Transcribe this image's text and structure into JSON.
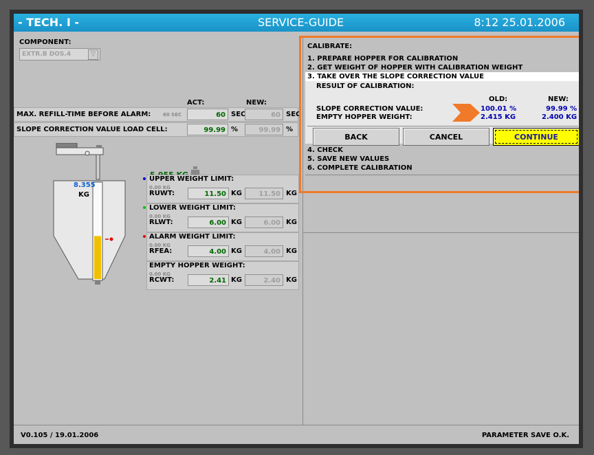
{
  "titlebar": {
    "left": "- TECH. I -",
    "center": "SERVICE-GUIDE",
    "right": "8:12  25.01.2006"
  },
  "component": {
    "label": "COMPONENT:",
    "value": "EXTR.B DOS.4"
  },
  "columns": {
    "act": "ACT:",
    "new": "NEW:"
  },
  "params": [
    {
      "label": "MAX. REFILL-TIME BEFORE ALARM:",
      "small": "60 SEC",
      "act": "60",
      "act_unit": "SEC",
      "new": "60",
      "new_unit": "SEC"
    },
    {
      "label": "SLOPE CORRECTION VALUE LOAD CELL:",
      "act": "99.99",
      "act_unit": "%",
      "new": "99.99",
      "new_unit": "%"
    }
  ],
  "hopper": {
    "weight": "5.955 KG",
    "level_value": "8.355",
    "level_unit": "KG",
    "fill_fraction": 0.45
  },
  "limits": [
    {
      "title": "UPPER WEIGHT LIMIT:",
      "small": "0.00 KG",
      "code": "RUWT:",
      "act": "11.50",
      "unit": "KG",
      "new": "11.50",
      "new_unit": "KG",
      "color": "#0000d0"
    },
    {
      "title": "LOWER WEIGHT LIMIT:",
      "small": "0.00 KG",
      "code": "RLWT:",
      "act": "6.00",
      "unit": "KG",
      "new": "6.00",
      "new_unit": "KG",
      "color": "#00c000"
    },
    {
      "title": "ALARM WEIGHT LIMIT:",
      "small": "0.00 KG",
      "code": "RFEA:",
      "act": "4.00",
      "unit": "KG",
      "new": "4.00",
      "new_unit": "KG",
      "color": "#e00000"
    },
    {
      "title": "EMPTY HOPPER WEIGHT:",
      "small": "0.00 KG",
      "code": "RCWT:",
      "act": "2.41",
      "unit": "KG",
      "new": "2.40",
      "new_unit": "KG",
      "color": ""
    }
  ],
  "calibrate": {
    "title": "CALIBRATE:",
    "steps": [
      "1. PREPARE HOPPER FOR CALIBRATION",
      "2. GET WEIGHT OF HOPPER WITH CALIBRATION WEIGHT",
      "3. TAKE OVER THE SLOPE CORRECTION VALUE"
    ],
    "result_title": "RESULT OF CALIBRATION:",
    "old_label": "OLD:",
    "new_label": "NEW:",
    "slope_label": "SLOPE CORRECTION VALUE:",
    "slope_old": "100.01 %",
    "slope_new": "99.99 %",
    "empty_label": "EMPTY HOPPER WEIGHT:",
    "empty_old": "2.415 KG",
    "empty_new": "2.400 KG",
    "buttons": {
      "back": "BACK",
      "cancel": "CANCEL",
      "continue": "CONTINUE"
    },
    "steps_after": [
      "4. CHECK",
      "5. SAVE NEW VALUES",
      "6. COMPLETE CALIBRATION"
    ]
  },
  "footer": {
    "version": "V0.105 / 19.01.2006",
    "status": "PARAMETER SAVE O.K."
  },
  "colors": {
    "title": "#1a92c8",
    "highlight": "#f07a2a",
    "continue": "#ffff00"
  }
}
